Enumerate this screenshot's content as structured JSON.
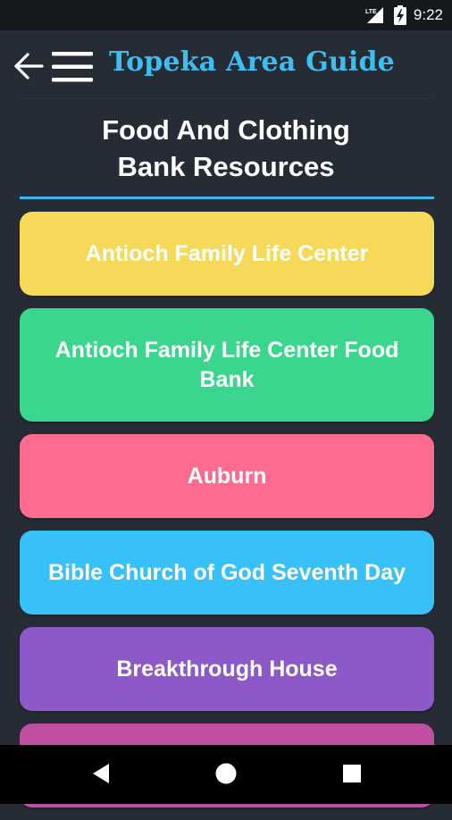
{
  "status_bar": {
    "network": "LTE",
    "time": "9:22"
  },
  "app_bar": {
    "title": "Topeka Area Guide"
  },
  "page": {
    "title_line1": "Food And Clothing",
    "title_line2": "Bank Resources"
  },
  "items": [
    {
      "label": "Antioch Family Life Center",
      "color": "#f7d959"
    },
    {
      "label": "Antioch Family Life Center Food Bank",
      "color": "#3bd68d"
    },
    {
      "label": "Auburn",
      "color": "#ff6b8f"
    },
    {
      "label": "Bible Church of God Seventh Day",
      "color": "#38c1f8"
    },
    {
      "label": "Breakthrough House",
      "color": "#8d58c8"
    },
    {
      "label": "",
      "color": "#c04fa4"
    }
  ],
  "colors": {
    "background": "#262c35",
    "accent": "#3dbdf0"
  }
}
